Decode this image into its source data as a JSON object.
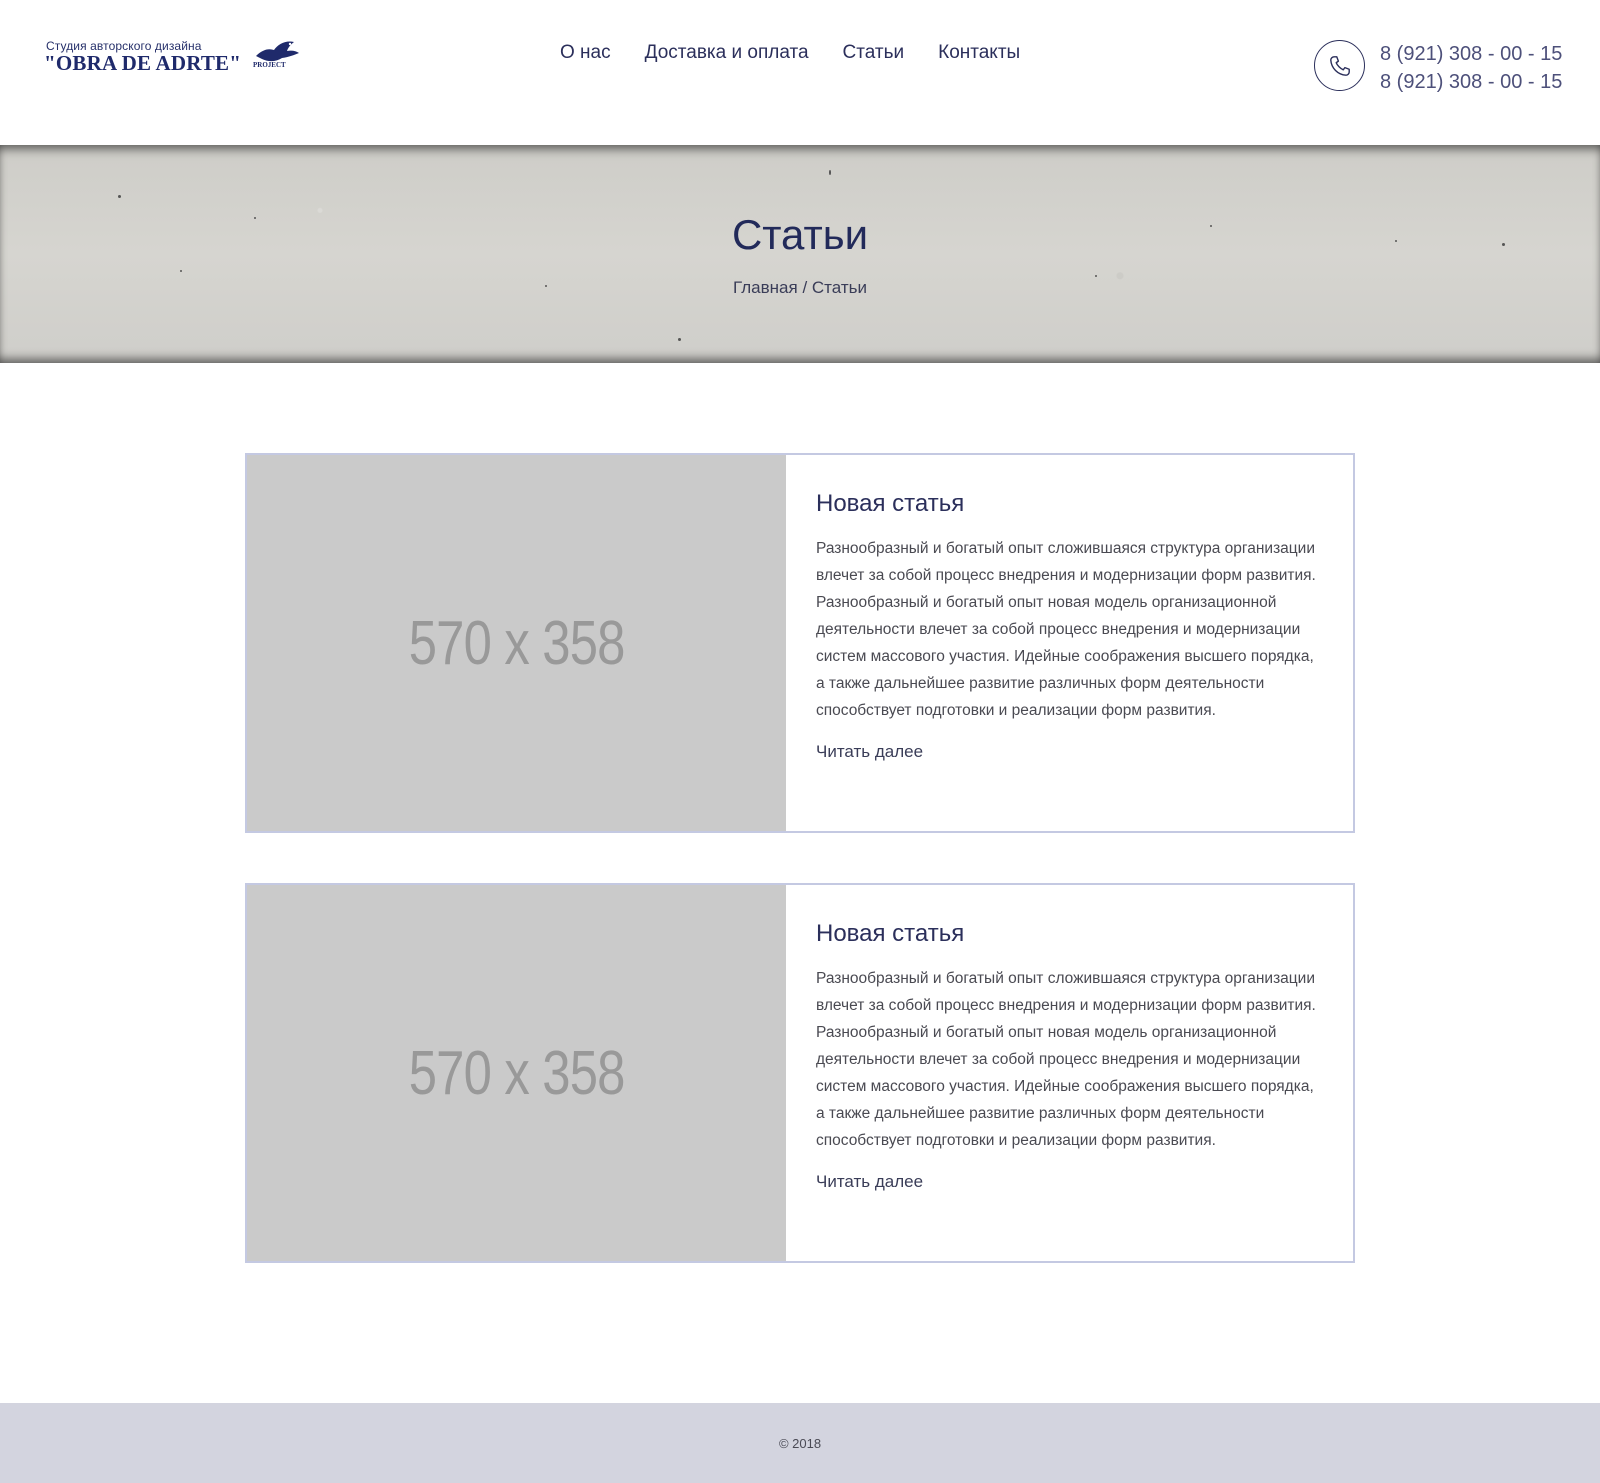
{
  "header": {
    "logo": {
      "subtitle": "Студия авторского дизайна",
      "name": "\"OBRA DE ADRTE\"",
      "project": "PROJECT"
    },
    "nav": [
      {
        "label": "О нас"
      },
      {
        "label": "Доставка и оплата"
      },
      {
        "label": "Статьи"
      },
      {
        "label": "Контакты"
      }
    ],
    "phone_icon": "phone-icon",
    "phones": [
      "8 (921) 308 - 00 - 15",
      "8 (921) 308 - 00 - 15"
    ]
  },
  "hero": {
    "title": "Статьи",
    "breadcrumb": {
      "home": "Главная",
      "separator": " / ",
      "current": "Статьи"
    }
  },
  "articles": [
    {
      "image_label": "570 x 358",
      "title": "Новая статья",
      "text": "Разнообразный и богатый опыт сложившаяся структура организации влечет за собой процесс внедрения и модернизации форм развития. Разнообразный и богатый опыт новая модель организационной деятельности влечет за собой процесс внедрения и модернизации систем массового участия. Идейные соображения высшего порядка, а также дальнейшее развитие различных форм деятельности способствует подготовки и реализации форм развития.",
      "more": "Читать далее"
    },
    {
      "image_label": "570 x 358",
      "title": "Новая статья",
      "text": "Разнообразный и богатый опыт сложившаяся структура организации влечет за собой процесс внедрения и модернизации форм развития. Разнообразный и богатый опыт новая модель организационной деятельности влечет за собой процесс внедрения и модернизации систем массового участия. Идейные соображения высшего порядка, а также дальнейшее развитие различных форм деятельности способствует подготовки и реализации форм развития.",
      "more": "Читать далее"
    }
  ],
  "footer": {
    "copyright": "© 2018"
  },
  "colors": {
    "brand": "#1f2a6b",
    "text": "#2b2f5b",
    "card_border": "#c4c9e2",
    "footer_bg": "#d3d4df",
    "image_placeholder": "#cacaca"
  }
}
